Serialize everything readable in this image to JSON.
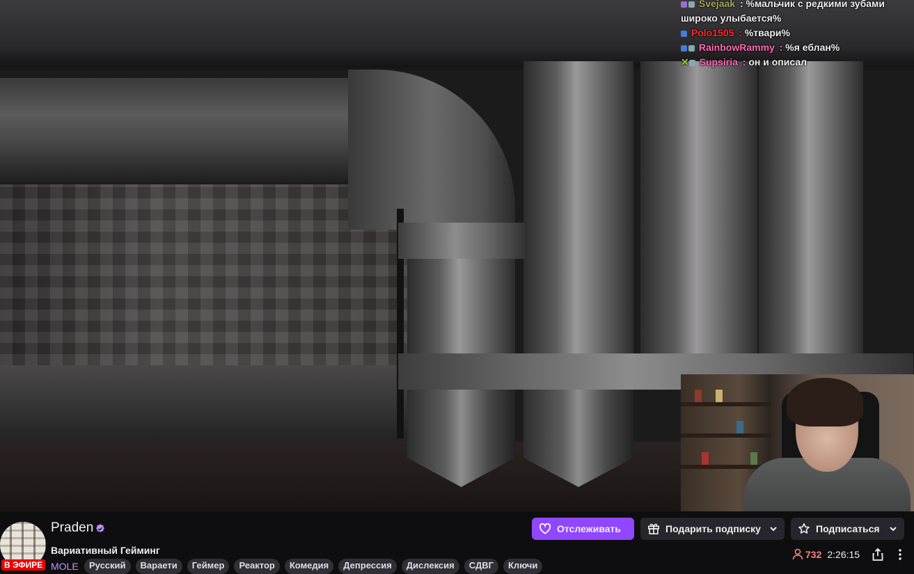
{
  "chat": {
    "messages": [
      {
        "user": "Svejaak",
        "sep": " :",
        "text": "%мальчик с редкими зубами",
        "color": "#a8a860"
      },
      {
        "user": "",
        "sep": "",
        "text": "широко улыбается%",
        "color": "#ffffff"
      },
      {
        "user": "Polo1505",
        "sep": " :",
        "text": "%твари%",
        "color": "#ff2a2a"
      },
      {
        "user": "RainbowRammy",
        "sep": " :",
        "text": "%я еблан%",
        "color": "#ff69b4"
      },
      {
        "user": "Supsiria",
        "sep": " :",
        "text": "он и описал",
        "color": "#ff69b4"
      }
    ]
  },
  "channel": {
    "name": "Praden",
    "live_label": "В ЭФИРЕ",
    "title": "Вариативный Гейминг",
    "category": "MOLE",
    "tags": [
      "Русский",
      "Варaети",
      "Геймер",
      "Реактор",
      "Комедия",
      "Депрессия",
      "Дислексия",
      "СДВГ",
      "Ключи"
    ]
  },
  "actions": {
    "follow_label": "Отслеживать",
    "gift_label": "Подарить подписку",
    "subscribe_label": "Подписаться"
  },
  "stats": {
    "viewers": "732",
    "uptime": "2:26:15"
  },
  "colors": {
    "accent": "#9147ff",
    "live": "#eb0400",
    "viewers": "#ff8280"
  },
  "icons": [
    "verified-icon",
    "heart-icon",
    "gift-icon",
    "star-icon",
    "chevron-down-icon",
    "person-icon",
    "share-icon",
    "more-icon"
  ]
}
